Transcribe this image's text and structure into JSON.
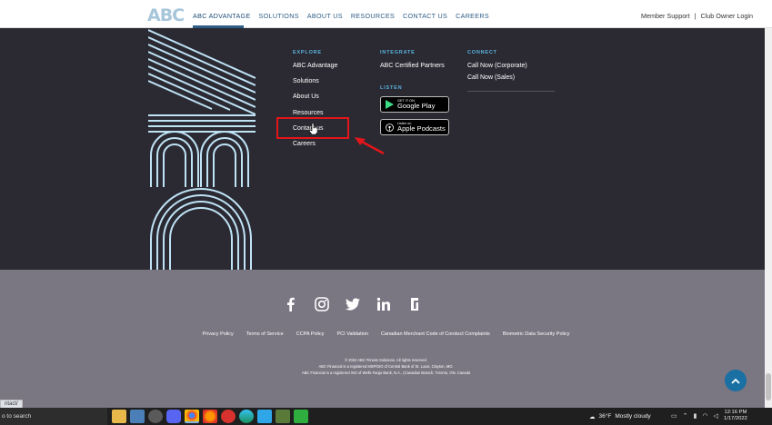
{
  "nav": {
    "logo": "ABC",
    "items": [
      "ABC ADVANTAGE",
      "SOLUTIONS",
      "ABOUT US",
      "RESOURCES",
      "CONTACT US",
      "CAREERS"
    ],
    "member_support": "Member Support",
    "separator": "|",
    "club_owner_login": "Club Owner Login"
  },
  "footer": {
    "explore": {
      "heading": "EXPLORE",
      "links": [
        "ABC Advantage",
        "Solutions",
        "About Us",
        "Resources",
        "Contact us",
        "Careers"
      ]
    },
    "integrate": {
      "heading": "INTEGRATE",
      "links": [
        "ABC Certified Partners"
      ]
    },
    "listen": {
      "heading": "LISTEN",
      "google_play_small": "GET IT ON",
      "google_play_big": "Google Play",
      "apple_small": "Listen on",
      "apple_big": "Apple Podcasts"
    },
    "connect": {
      "heading": "CONNECT",
      "links": [
        "Call Now (Corporate)",
        "Call Now (Sales)"
      ]
    }
  },
  "legal": {
    "links": [
      "Privacy Policy",
      "Terms of Service",
      "CCPA Policy",
      "PCI Validation",
      "Canadian Merchant Code of Conduct Complaints",
      "Biometric Data Security Policy"
    ],
    "copyright": [
      "© 2022 ABC Fitness Solutions. All rights reserved.",
      "ABC Financial is a registered MSP/ISO of Central Bank of St. Louis, Clayton, MO.",
      "ABC Financial is a registered ISO of Wells Fargo Bank, N.A., (Canadian Branch, Toronto, ON, Canada"
    ]
  },
  "status": {
    "url_preview": "ntact/"
  },
  "taskbar": {
    "search": "o to search",
    "weather_temp": "36°F",
    "weather_desc": "Mostly cloudy",
    "time": "12:16 PM",
    "date": "1/17/2022"
  },
  "colors": {
    "accent": "#59b3de",
    "highlight": "#e2161b",
    "dark_bg": "#2b2a33",
    "grey_bg": "#7a7682"
  }
}
